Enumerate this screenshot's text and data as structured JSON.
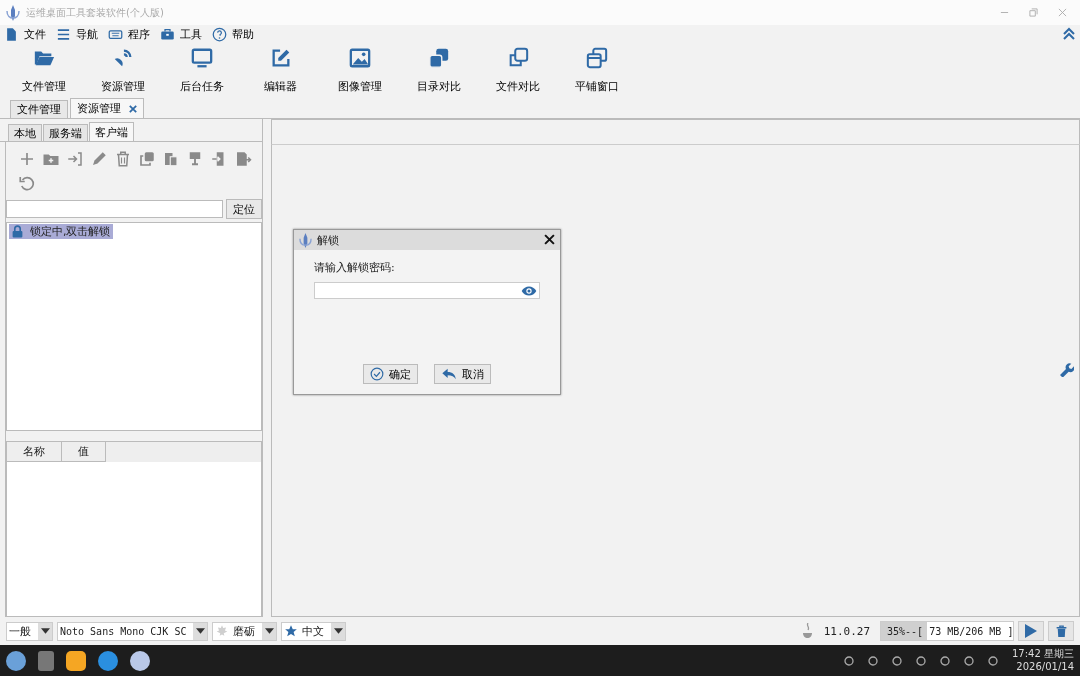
{
  "window": {
    "title": "运维桌面工具套装软件(个人版)"
  },
  "menu": [
    {
      "label": "文件"
    },
    {
      "label": "导航"
    },
    {
      "label": "程序"
    },
    {
      "label": "工具"
    },
    {
      "label": "帮助"
    }
  ],
  "toolbar": [
    {
      "label": "文件管理"
    },
    {
      "label": "资源管理"
    },
    {
      "label": "后台任务"
    },
    {
      "label": "编辑器"
    },
    {
      "label": "图像管理"
    },
    {
      "label": "目录对比"
    },
    {
      "label": "文件对比"
    },
    {
      "label": "平铺窗口"
    }
  ],
  "doc_tabs": [
    {
      "label": "文件管理",
      "selected": false
    },
    {
      "label": "资源管理",
      "selected": true
    }
  ],
  "side_tabs": [
    {
      "label": "本地",
      "selected": false
    },
    {
      "label": "服务端",
      "selected": false
    },
    {
      "label": "客户端",
      "selected": true
    }
  ],
  "locate_button": "定位",
  "tree": [
    {
      "label": "锁定中,双击解锁",
      "selected": true
    }
  ],
  "properties": {
    "columns": [
      "名称",
      "值"
    ]
  },
  "dialog": {
    "title": "解锁",
    "prompt": "请输入解锁密码:",
    "buttons": [
      {
        "label": "确定",
        "kind": "ok"
      },
      {
        "label": "取消",
        "kind": "cancel"
      }
    ]
  },
  "status_bar": {
    "combos": [
      {
        "value": "一般"
      },
      {
        "value": "Noto Sans Mono CJK SC"
      },
      {
        "value": "磨砺"
      },
      {
        "value": "中文"
      }
    ],
    "java_version": "11.0.27",
    "memory": {
      "label": "35%--[ 73 MB/206 MB ]",
      "level": 0.35
    }
  },
  "taskbar": {
    "time": "17:42 星期三",
    "date": "2026/01/14"
  }
}
